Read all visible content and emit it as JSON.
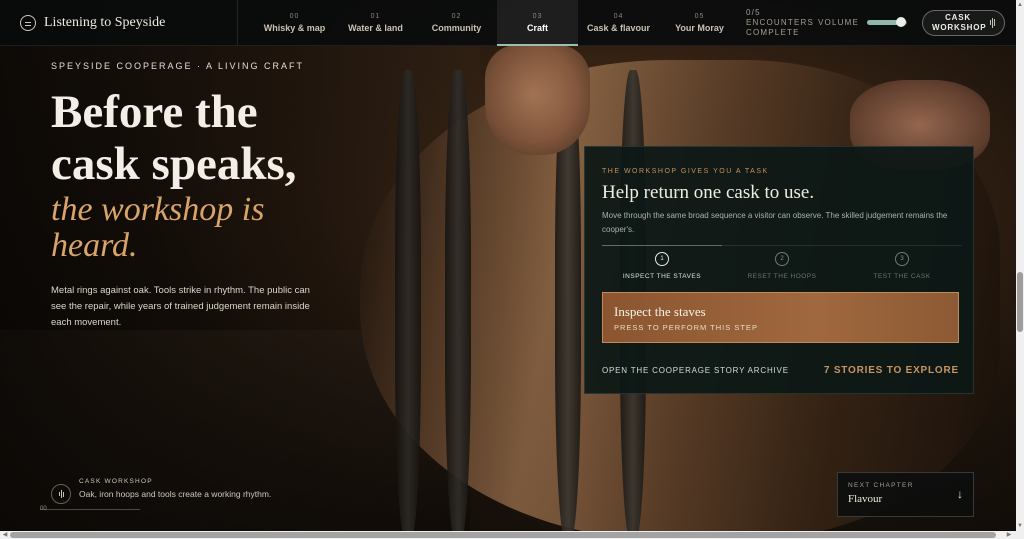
{
  "brand": {
    "title": "Listening to Speyside"
  },
  "nav": {
    "items": [
      {
        "num": "00",
        "label": "Whisky & map"
      },
      {
        "num": "01",
        "label": "Water & land"
      },
      {
        "num": "02",
        "label": "Community"
      },
      {
        "num": "03",
        "label": "Craft",
        "active": true
      },
      {
        "num": "04",
        "label": "Cask & flavour"
      },
      {
        "num": "05",
        "label": "Your Moray"
      }
    ],
    "encounters": "0/5 ENCOUNTERS COMPLETE",
    "volume_label": "VOLUME",
    "volume_level": 0.85,
    "cask_button": "CASK WORKSHOP"
  },
  "hero": {
    "eyebrow": "SPEYSIDE COOPERAGE · A LIVING CRAFT",
    "headline": "Before the cask speaks,",
    "headline_em": "the workshop is heard.",
    "lede": "Metal rings against oak. Tools strike in rhythm. The public can see the repair, while years of trained judgement remain inside each movement."
  },
  "panel": {
    "eyebrow": "THE WORKSHOP GIVES YOU A TASK",
    "title": "Help return one cask to use.",
    "description": "Move through the same broad sequence a visitor can observe. The skilled judgement remains the cooper's.",
    "steps": [
      {
        "num": "1",
        "label": "INSPECT THE STAVES",
        "active": true
      },
      {
        "num": "2",
        "label": "RESET THE HOOPS"
      },
      {
        "num": "3",
        "label": "TEST THE CASK"
      }
    ],
    "action_title": "Inspect the staves",
    "action_sub": "PRESS TO PERFORM THIS STEP",
    "archive_link": "OPEN THE COOPERAGE STORY ARCHIVE",
    "stories_link": "7 STORIES TO EXPLORE"
  },
  "audio": {
    "tag": "CASK WORKSHOP",
    "text": "Oak, iron hoops and tools create a working rhythm.",
    "marker": "00"
  },
  "next_chapter": {
    "tag": "NEXT CHAPTER",
    "title": "Flavour",
    "arrow": "↓"
  },
  "colors": {
    "accent": "#c89462",
    "accent_alt": "#9ac0b0",
    "italic_gold": "#d9a46a"
  }
}
